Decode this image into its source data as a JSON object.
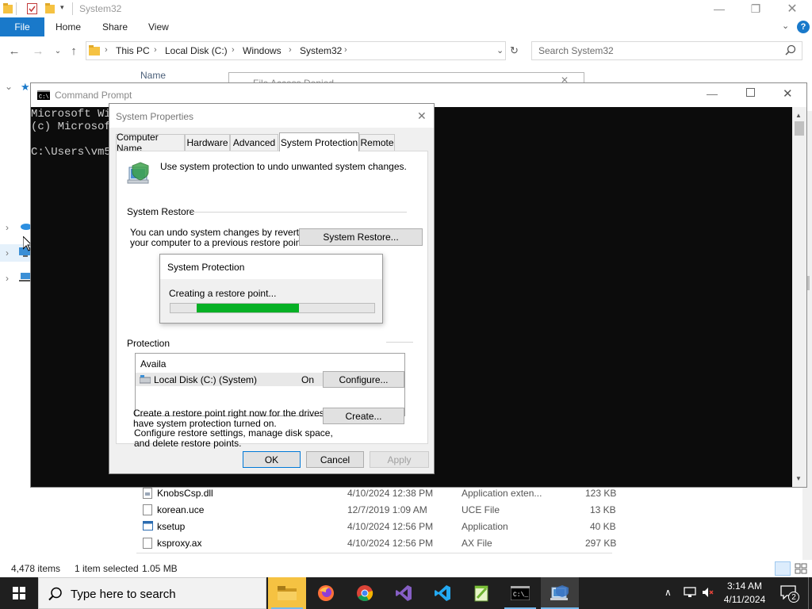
{
  "explorer": {
    "title": "System32",
    "ribbon": {
      "file": "File",
      "home": "Home",
      "share": "Share",
      "view": "View"
    },
    "breadcrumb": [
      "This PC",
      "Local Disk (C:)",
      "Windows",
      "System32"
    ],
    "search_placeholder": "Search System32",
    "column_name": "Name",
    "files": [
      {
        "name": "KnobsCsp.dll",
        "date": "4/10/2024 12:38 PM",
        "type": "Application exten...",
        "size": "123 KB"
      },
      {
        "name": "korean.uce",
        "date": "12/7/2019 1:09 AM",
        "type": "UCE File",
        "size": "13 KB"
      },
      {
        "name": "ksetup",
        "date": "4/10/2024 12:56 PM",
        "type": "Application",
        "size": "40 KB"
      },
      {
        "name": "ksproxy.ax",
        "date": "4/10/2024 12:56 PM",
        "type": "AX File",
        "size": "297 KB"
      }
    ],
    "status": {
      "items": "4,478 items",
      "selected": "1 item selected",
      "size": "1.05 MB"
    }
  },
  "cmd": {
    "title": "Command Prompt",
    "lines": [
      "Microsoft Wi",
      "(c) Microsof",
      "",
      "C:\\Users\\vm5"
    ]
  },
  "background_dialog": {
    "title": "File Access Denied"
  },
  "system_properties": {
    "title": "System Properties",
    "tabs": [
      "Computer Name",
      "Hardware",
      "Advanced",
      "System Protection",
      "Remote"
    ],
    "active_tab": "System Protection",
    "intro": "Use system protection to undo unwanted system changes.",
    "restore_group": "System Restore",
    "restore_text_1": "You can undo system changes by reverting",
    "restore_text_2": "your computer to a previous restore point.",
    "restore_button": "System Restore...",
    "protection_group": "Protection",
    "available_header": "Availa",
    "drive_name": "Local Disk (C:) (System)",
    "drive_status": "On",
    "configure_text_1": "Configure restore settings, manage disk space,",
    "configure_text_2": "and delete restore points.",
    "configure_button": "Configure...",
    "create_text_1": "Create a restore point right now for the drives that",
    "create_text_2": "have system protection turned on.",
    "create_button": "Create...",
    "ok": "OK",
    "cancel": "Cancel",
    "apply": "Apply"
  },
  "progress_popup": {
    "title": "System Protection",
    "message": "Creating a restore point...",
    "progress_fraction": 0.5
  },
  "taskbar": {
    "search_placeholder": "Type here to search",
    "time": "3:14 AM",
    "date": "4/11/2024",
    "notification_count": "2",
    "apps": [
      "file-explorer",
      "firefox",
      "chrome",
      "visual-studio",
      "vscode",
      "notepad-plus-plus",
      "command-prompt",
      "system-properties"
    ]
  },
  "colors": {
    "accent": "#1979ca",
    "progress": "#06b025",
    "taskbar": "#1f1f1f",
    "cmd_bg": "#0c0c0c"
  }
}
